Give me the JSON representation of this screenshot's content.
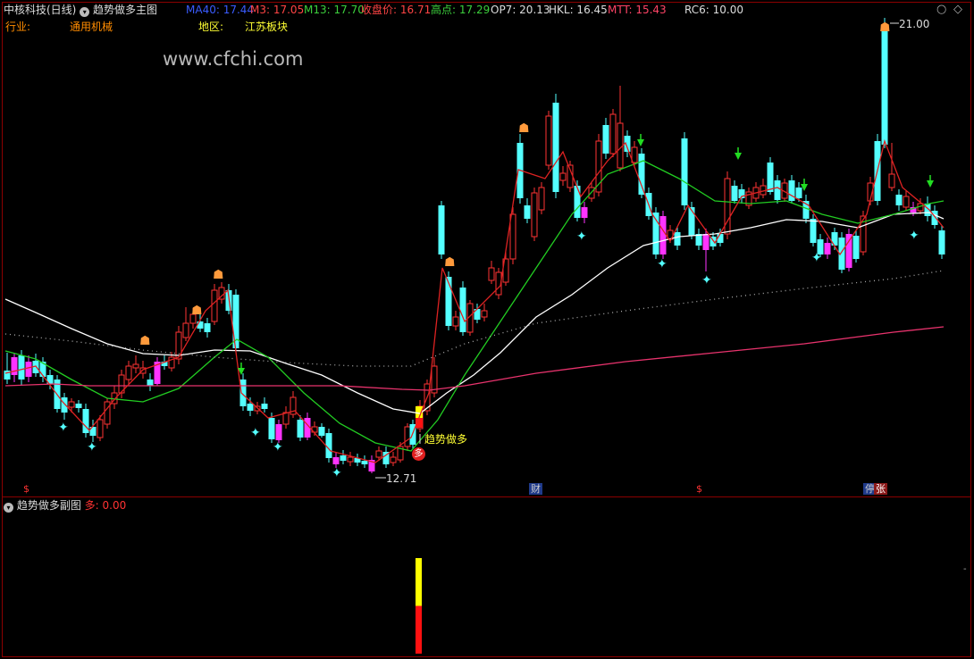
{
  "header": {
    "stock_title": "中核科技(日线)",
    "indicator_title": "趋势做多主图",
    "ma40": "MA40: 17.44",
    "m3": "M3: 17.05",
    "m13": "M13: 17.70",
    "close": "收盘价: 16.71",
    "high": "高点: 17.29",
    "op7": "OP7: 20.13",
    "hkl": "HKL: 16.45",
    "mtt": "MTT: 15.43",
    "rc6": "RC6: 10.00"
  },
  "info": {
    "industry_label": "行业:",
    "industry_value": "通用机械",
    "region_label": "地区:",
    "region_value": "江苏板块"
  },
  "watermark": "www.cfchi.com",
  "annotations": {
    "high_price": "21.00",
    "low_price": "12.71",
    "signal_text": "趋势做多",
    "signal_badge": "多"
  },
  "axis_markers": {
    "m1": "$",
    "m2": "财",
    "m3": "$",
    "m4": "停",
    "m5": "张"
  },
  "sub_panel": {
    "title": "趋势做多副图",
    "value": "多: 0.00"
  },
  "colors": {
    "up": "#ff3333",
    "down": "#54ffff",
    "special": "#ff33ff",
    "ma_white": "#ffffff",
    "ma_green": "#22cc22",
    "ma_pink": "#e8336d"
  },
  "chart_data": {
    "type": "candlestick",
    "y_range": [
      12.71,
      21.0
    ],
    "signal_bar": {
      "yellow_portion": 0.5,
      "red_portion": 0.5
    }
  }
}
